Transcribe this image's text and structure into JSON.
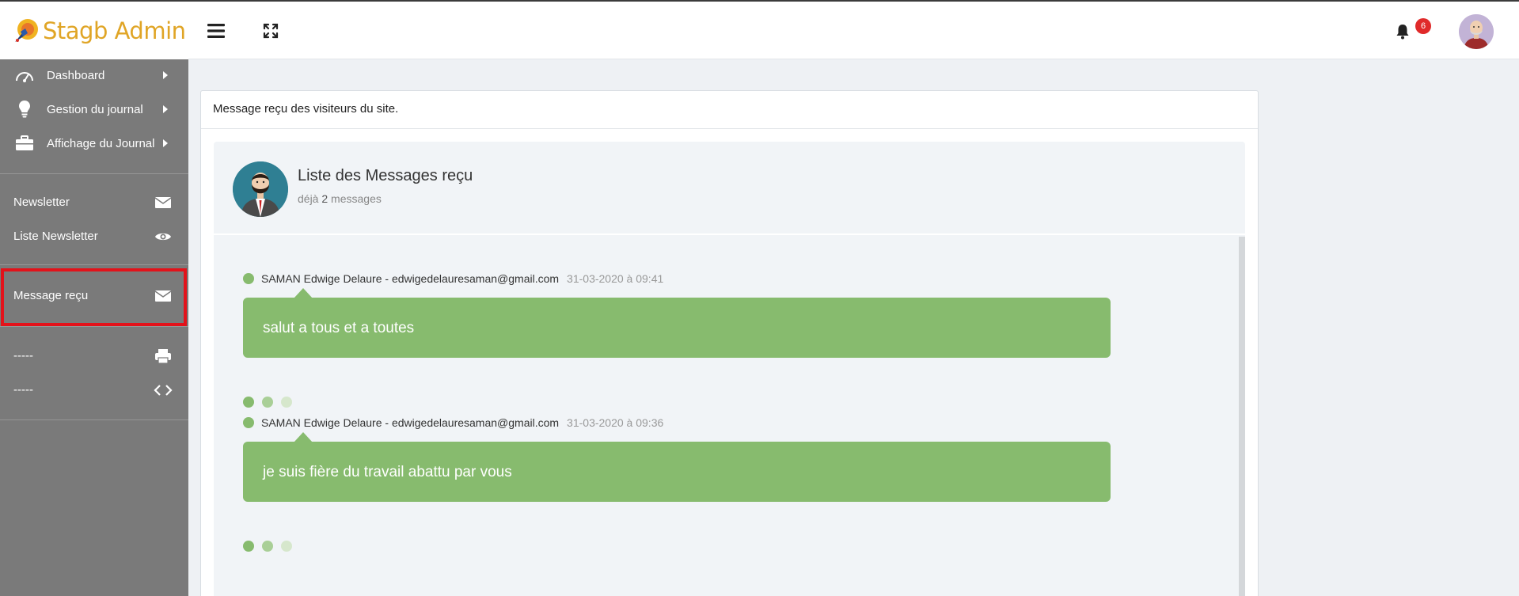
{
  "app": {
    "brand": "Stagb Admin",
    "brand_color": "#e0a526"
  },
  "header": {
    "notification_count": "6",
    "badge_color": "#e02a2a"
  },
  "sidebar": {
    "background": "#7a7a7a",
    "nav": [
      {
        "label": "Dashboard",
        "icon": "speedometer-icon"
      },
      {
        "label": "Gestion du journal",
        "icon": "lightbulb-icon"
      },
      {
        "label": "Affichage du Journal",
        "icon": "briefcase-icon"
      }
    ],
    "items": [
      {
        "label": "Newsletter",
        "icon": "envelope-icon"
      },
      {
        "label": "Liste Newsletter",
        "icon": "eye-icon"
      },
      {
        "label": "Message reçu",
        "icon": "envelope-icon",
        "active": true
      },
      {
        "label": "-----",
        "icon": "printer-icon"
      },
      {
        "label": "-----",
        "icon": "code-icon"
      }
    ]
  },
  "main": {
    "card_title": "Message reçu des visiteurs du site.",
    "inbox": {
      "title": "Liste des Messages reçu",
      "subtitle_prefix": "déjà",
      "count": "2",
      "subtitle_suffix": "messages"
    },
    "messages": [
      {
        "sender": "SAMAN Edwige Delaure - edwigedelauresaman@gmail.com",
        "time": "31-03-2020 à 09:41",
        "text": "salut a tous et a toutes"
      },
      {
        "sender": "SAMAN Edwige Delaure - edwigedelauresaman@gmail.com",
        "time": "31-03-2020 à 09:36",
        "text": "je suis fière du travail abattu par vous"
      }
    ],
    "bubble_color": "#87bb6e"
  }
}
